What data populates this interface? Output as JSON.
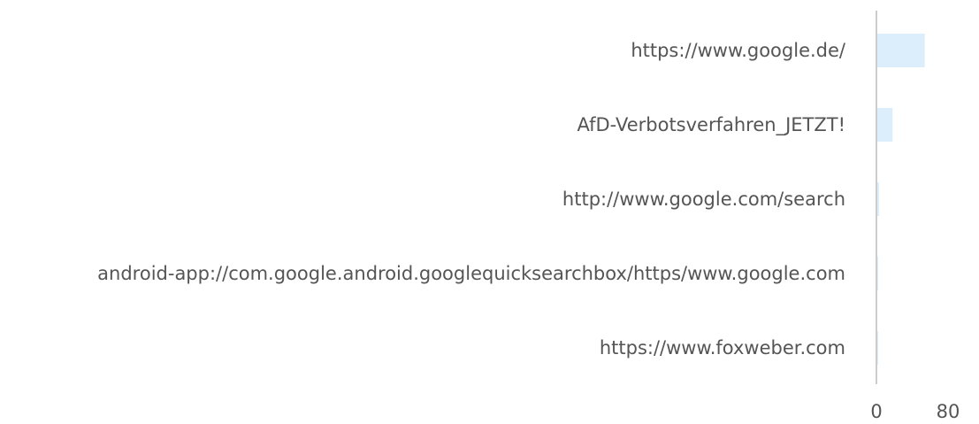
{
  "chart_data": {
    "type": "bar",
    "orientation": "horizontal",
    "categories": [
      "https://www.google.de/",
      "AfD-Verbotsverfahren_JETZT!",
      "http://www.google.com/search",
      "android-app://com.google.android.googlequicksearchbox/https/www.google.com",
      "https://www.foxweber.com"
    ],
    "values": [
      53,
      17,
      2,
      1,
      1
    ],
    "xlim": [
      0,
      80
    ],
    "xticks": [
      "0",
      "80"
    ],
    "title": "",
    "xlabel": "",
    "ylabel": "",
    "grid": false,
    "legend": "none",
    "bar_color": "#dcedfc",
    "axis_color": "#bbbbbb"
  }
}
